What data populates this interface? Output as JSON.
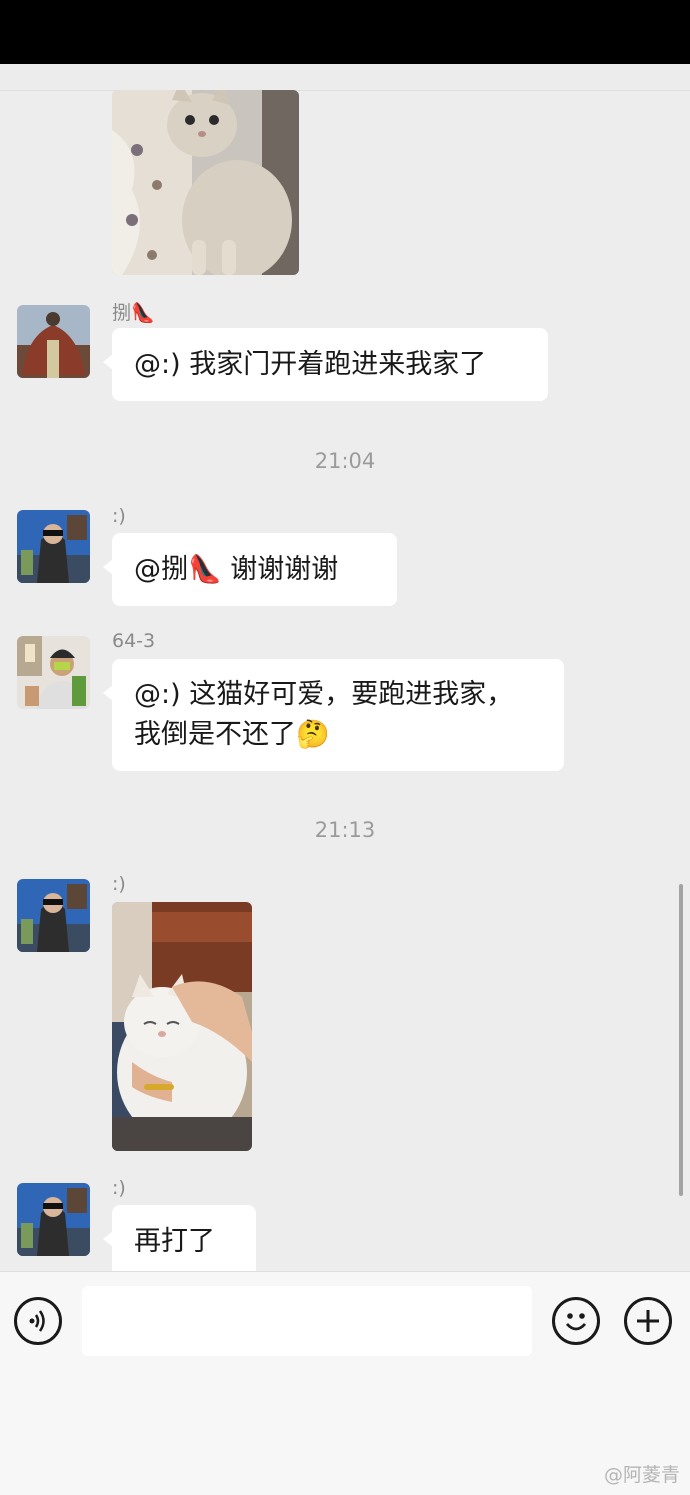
{
  "messages": [
    {
      "sender": "捌👠",
      "text": "@:) 我家门开着跑进来我家了"
    },
    {
      "sender": ":)",
      "text": "@捌👠 谢谢谢谢"
    },
    {
      "sender": "64-3",
      "text_line1": "@:) 这猫好可爱，要跑进我家，",
      "text_line2": "我倒是不还了🤔"
    },
    {
      "sender": ":)"
    },
    {
      "sender": ":)",
      "text": "再打了"
    }
  ],
  "timestamps": [
    "21:04",
    "21:13"
  ],
  "watermark": "@阿菱青",
  "icons": {
    "voice": "voice-icon",
    "emoji": "emoji-icon",
    "plus": "plus-icon"
  }
}
